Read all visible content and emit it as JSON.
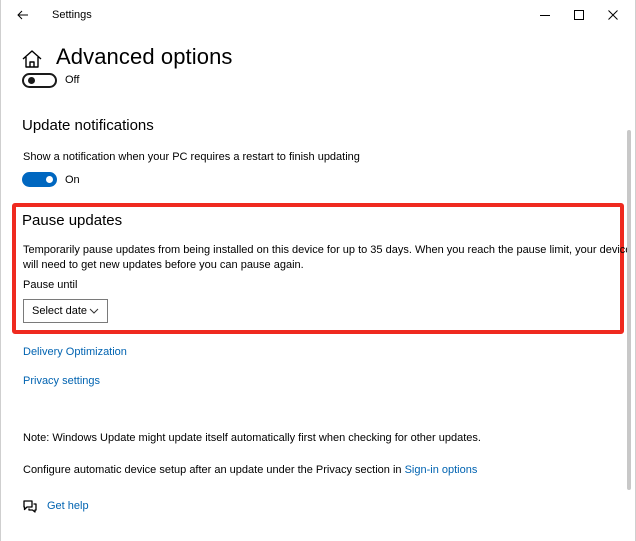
{
  "window": {
    "title": "Settings"
  },
  "header": {
    "title": "Advanced options"
  },
  "top_toggle": {
    "state_label": "Off"
  },
  "update_notifications": {
    "title": "Update notifications",
    "description": "Show a notification when your PC requires a restart to finish updating",
    "state_label": "On"
  },
  "pause_updates": {
    "title": "Pause updates",
    "description_line1": "Temporarily pause updates from being installed on this device for up to 35 days. When you reach the pause limit, your device",
    "description_line2": "will need to get new updates before you can pause again.",
    "pause_until_label": "Pause until",
    "select_value": "Select date"
  },
  "links": {
    "delivery_optimization": "Delivery Optimization",
    "privacy_settings": "Privacy settings"
  },
  "notes": {
    "note": "Note: Windows Update might update itself automatically first when checking for other updates.",
    "configure_text": "Configure automatic device setup after an update under the Privacy section in",
    "signin_link": "Sign-in options"
  },
  "help": {
    "label": "Get help"
  },
  "colors": {
    "accent": "#0067c0",
    "link": "#0063b1",
    "highlight": "#ef2a1f"
  }
}
